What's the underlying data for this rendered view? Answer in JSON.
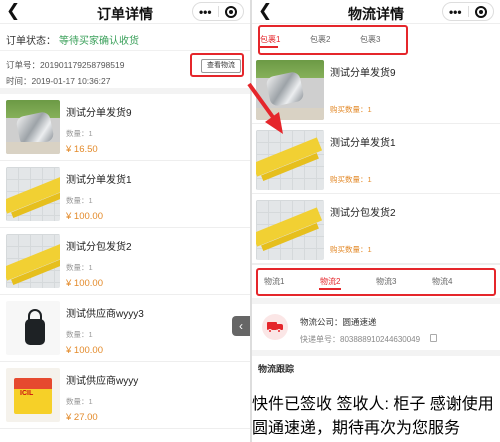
{
  "left": {
    "title": "订单详情",
    "status_label": "订单状态：",
    "status_value": "等待买家确认收货",
    "order_no": "订单号：201901179258798519",
    "order_time": "时间：2019-01-17 10:36:27",
    "check_logistics": "查看物流",
    "items": [
      {
        "name": "测试分单发货9",
        "qty": "数量：1",
        "price": "¥ 16.50"
      },
      {
        "name": "测试分单发货1",
        "qty": "数量：1",
        "price": "¥ 100.00"
      },
      {
        "name": "测试分包发货2",
        "qty": "数量：1",
        "price": "¥ 100.00"
      },
      {
        "name": "测试供应商wyyy3",
        "qty": "数量：1",
        "price": "¥ 100.00"
      },
      {
        "name": "测试供应商wyyy",
        "qty": "数量：1",
        "price": "¥ 27.00"
      }
    ]
  },
  "right": {
    "title": "物流详情",
    "package_tabs": [
      "包裹1",
      "包裹2",
      "包裹3"
    ],
    "items": [
      {
        "name": "测试分单发货9",
        "qty": "购买数量：1"
      },
      {
        "name": "测试分单发货1",
        "qty": "购买数量：1"
      },
      {
        "name": "测试分包发货2",
        "qty": "购买数量：1"
      }
    ],
    "logistics_tabs": [
      "物流1",
      "物流2",
      "物流3",
      "物流4"
    ],
    "carrier_name": "物流公司：圆通速递",
    "tracking_no": "快递单号：8038889102446300​49",
    "tracking_title": "物流跟踪",
    "tracking_text": "快件已签收 签收人: 柜子 感谢使用圆通速递，期待再次为您服务"
  },
  "colors": {
    "accent": "#e5262b",
    "price": "#e38a2a",
    "status_green": "#3aa05a"
  }
}
